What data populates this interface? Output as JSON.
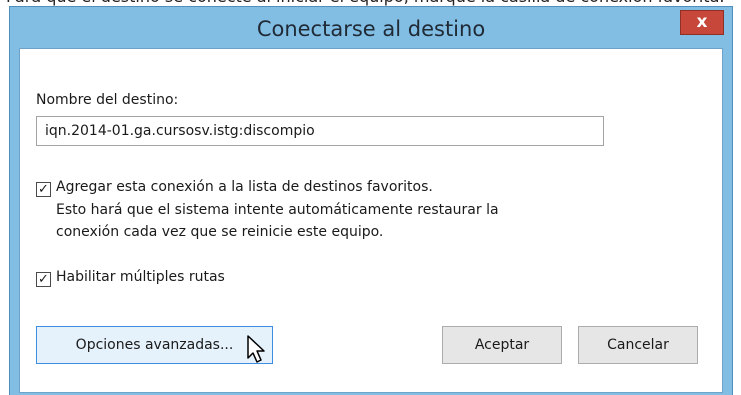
{
  "window": {
    "title": "Conectarse al destino",
    "close_label": "x"
  },
  "target_name": {
    "label": "Nombre del destino:",
    "value": "iqn.2014-01.ga.cursosv.istg:discompio"
  },
  "favorites": {
    "checked": true,
    "label": "Agregar esta conexión a la lista de destinos favoritos.",
    "description_line1": "Esto hará que el sistema intente automáticamente restaurar la",
    "description_line2": "conexión cada vez que se reinicie este equipo."
  },
  "multipath": {
    "checked": true,
    "label": "Habilitar múltiples rutas"
  },
  "buttons": {
    "advanced": "Opciones avanzadas...",
    "ok": "Aceptar",
    "cancel": "Cancelar"
  },
  "icons": {
    "close": "close-icon",
    "checkmark": "checkmark-icon",
    "cursor": "mouse-pointer-icon"
  }
}
